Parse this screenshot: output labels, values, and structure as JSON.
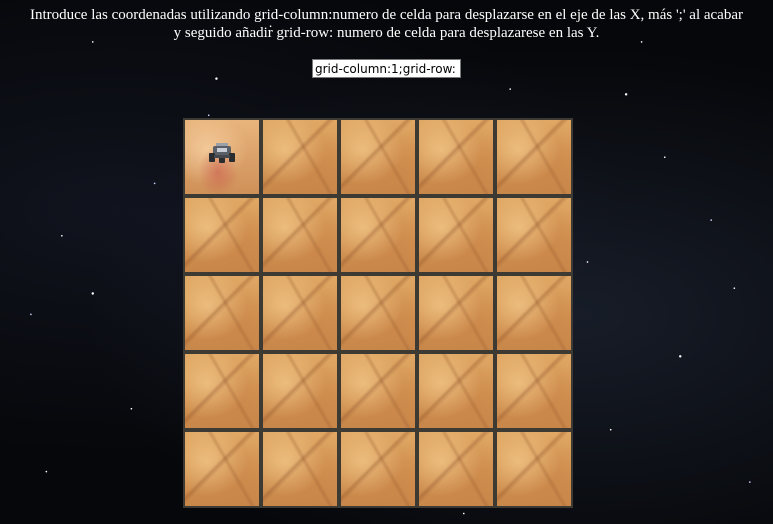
{
  "instructions": {
    "line1": "Introduce las coordenadas utilizando grid-column:numero de celda para desplazarse en el eje de las X, más ';' al acabar",
    "line2": "y seguido añadir grid-row: numero de celda para desplazarese en las Y."
  },
  "coordinate_input": {
    "value": "grid-column:1;grid-row:"
  },
  "board": {
    "columns": 5,
    "rows": 5,
    "rover_position": {
      "column": 1,
      "row": 1
    },
    "rover_icon": "rover-icon",
    "colors": {
      "terrain": "#d39452",
      "border": "#3d3a34",
      "background": "#06070a"
    }
  }
}
